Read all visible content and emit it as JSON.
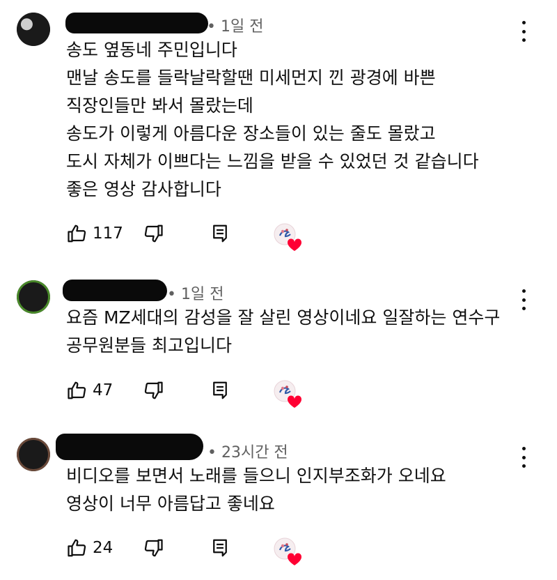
{
  "comments": [
    {
      "time": "• 1일 전",
      "lines": [
        "송도 옆동네 주민입니다",
        "맨날 송도를 들락날락할땐 미세먼지 낀 광경에 바쁜",
        "직장인들만 봐서 몰랐는데",
        "송도가 이렇게 아름다운 장소들이 있는 줄도 몰랐고",
        "도시 자체가 이쁘다는 느낌을 받을 수 있었던 것 같습니다",
        "좋은 영상 감사합니다"
      ],
      "likes": "117",
      "avatar_icon": "user-avatar-icon"
    },
    {
      "time": "• 1일 전",
      "lines": [
        "요즘 MZ세대의 감성을 잘 살린 영상이네요 일잘하는 연수구",
        "공무원분들 최고입니다"
      ],
      "likes": "47",
      "avatar_icon": "user-avatar-icon"
    },
    {
      "time": "• 23시간 전",
      "lines": [
        "비디오를 보면서 노래를 들으니 인지부조화가 오네요",
        "영상이 너무 아름답고 좋네요"
      ],
      "likes": "24",
      "avatar_icon": "user-avatar-icon"
    }
  ],
  "icons": {
    "like": "thumbs-up-icon",
    "dislike": "thumbs-down-icon",
    "reply": "reply-icon",
    "more": "more-vert-icon",
    "creator_heart": "creator-heart-icon"
  },
  "colors": {
    "text": "#0f0f0f",
    "meta": "#606060",
    "heart": "#ff0033"
  }
}
